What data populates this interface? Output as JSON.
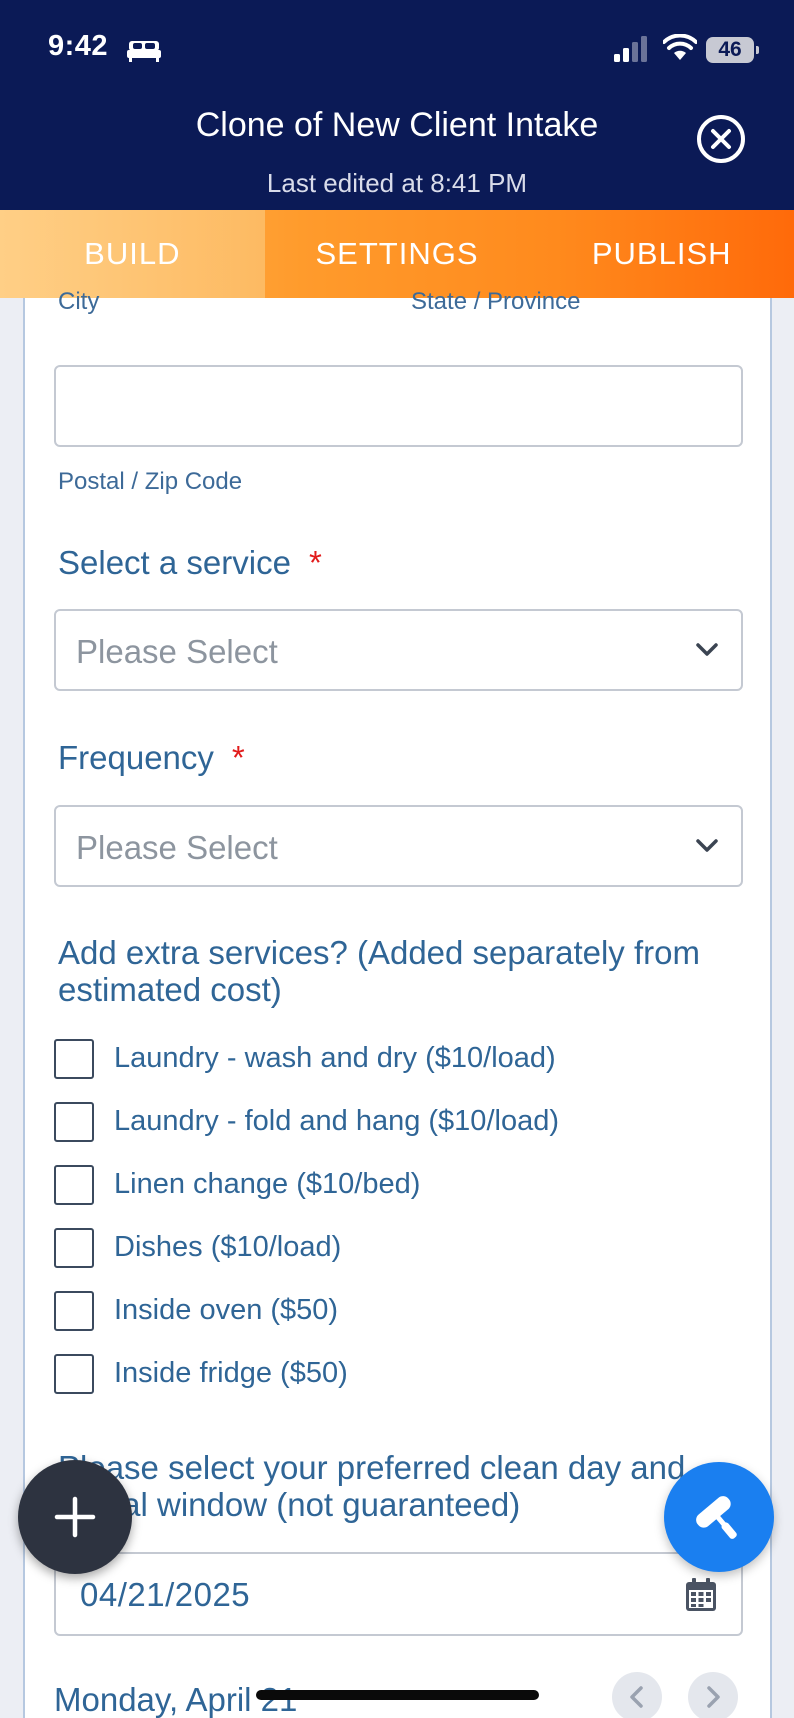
{
  "status_bar": {
    "time": "9:42",
    "battery": "46"
  },
  "header": {
    "title": "Clone of New Client Intake",
    "subtitle": "Last edited at 8:41 PM"
  },
  "tabs": [
    {
      "label": "BUILD",
      "active": true
    },
    {
      "label": "SETTINGS",
      "active": false
    },
    {
      "label": "PUBLISH",
      "active": false
    }
  ],
  "form": {
    "address": {
      "city_label": "City",
      "state_label": "State / Province",
      "zip_label": "Postal / Zip Code"
    },
    "service": {
      "label": "Select a service",
      "required_mark": "*",
      "placeholder": "Please Select"
    },
    "frequency": {
      "label": "Frequency",
      "required_mark": "*",
      "placeholder": "Please Select"
    },
    "extras": {
      "label": "Add extra services? (Added separately from estimated cost)",
      "options": [
        "Laundry - wash and dry ($10/load)",
        "Laundry - fold and hang ($10/load)",
        "Linen change ($10/bed)",
        "Dishes ($10/load)",
        "Inside oven ($50)",
        "Inside fridge ($50)"
      ]
    },
    "clean_day": {
      "label": "Please select your preferred clean day and arrival window (not guaranteed)",
      "date_value": "04/21/2025",
      "day_text": "Monday, April 21"
    }
  },
  "colors": {
    "header_bg": "#0b1a56",
    "accent_orange": "#ff8a1d",
    "label_blue": "#2f6596",
    "required_red": "#e21b1b",
    "fab_blue": "#1a7ff0"
  },
  "icons": {
    "close": "close-circle-icon",
    "chevron": "chevron-down-icon",
    "calendar": "calendar-icon",
    "add": "plus-icon",
    "design": "paint-roller-icon"
  }
}
